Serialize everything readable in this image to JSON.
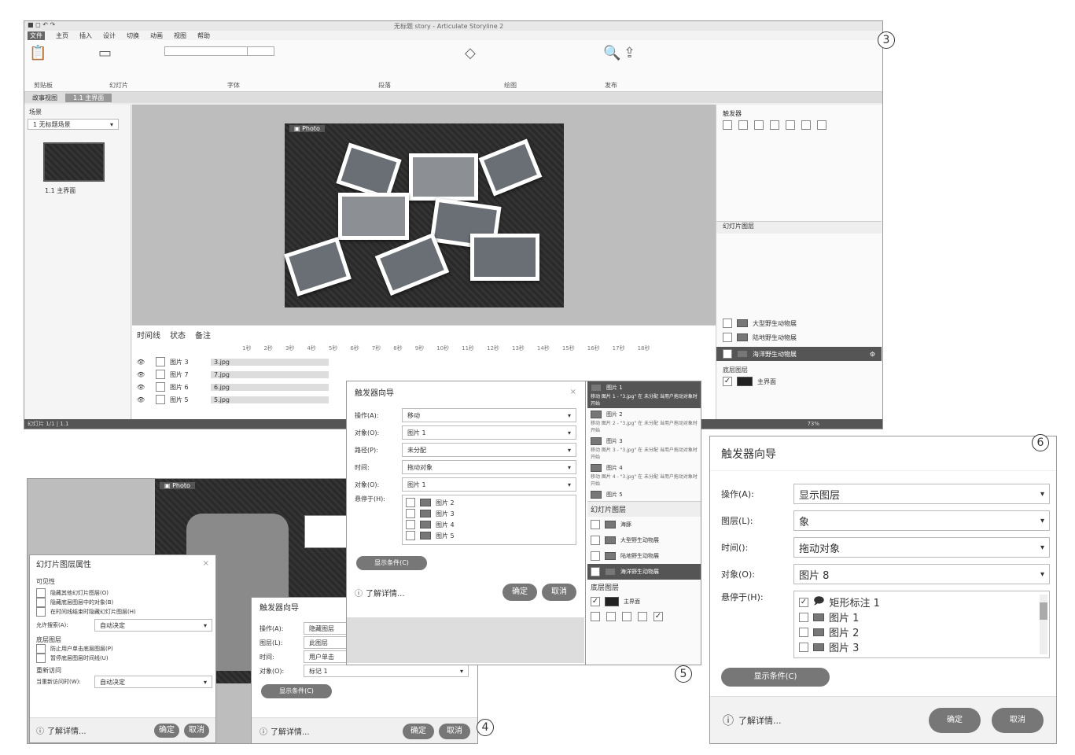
{
  "app": {
    "title": "无标题 story - Articulate Storyline 2",
    "ribbon_tabs": [
      "文件",
      "主页",
      "插入",
      "设计",
      "切换",
      "动画",
      "视图",
      "帮助"
    ],
    "ribbon_groups": [
      "剪贴板",
      "幻灯片",
      "字体",
      "段落",
      "绘图",
      "发布"
    ],
    "doc_tabs": [
      "故事视图",
      "1.1 主界面"
    ],
    "scene_panel": {
      "title": "场景",
      "dropdown": "1 无标题场景",
      "slide_label": "1.1 主界面"
    },
    "stage_tag": "Photo",
    "timeline_tabs": [
      "时间线",
      "状态",
      "备注"
    ],
    "timeline_rows": [
      {
        "name": "图片 3",
        "file": "3.jpg"
      },
      {
        "name": "图片 7",
        "file": "7.jpg"
      },
      {
        "name": "图片 6",
        "file": "6.jpg"
      },
      {
        "name": "图片 5",
        "file": "5.jpg"
      }
    ],
    "ruler": [
      "1秒",
      "2秒",
      "3秒",
      "4秒",
      "5秒",
      "6秒",
      "7秒",
      "8秒",
      "9秒",
      "10秒",
      "11秒",
      "12秒",
      "13秒",
      "14秒",
      "15秒",
      "16秒",
      "17秒",
      "18秒"
    ],
    "triggers_title": "触发器",
    "slide_layers_title": "幻灯片图层",
    "layers": [
      {
        "name": "大型野生动物展",
        "selected": false
      },
      {
        "name": "陆地野生动物展",
        "selected": false
      },
      {
        "name": "海洋野生动物展",
        "selected": true
      }
    ],
    "base_layer_title": "底层图层",
    "base_layer_name": "主界面",
    "status_left": "幻灯片 1/1 | 1.1",
    "zoom": "73%"
  },
  "labels": {
    "c3": "3",
    "c4": "4",
    "c5": "5",
    "c6": "6"
  },
  "dlg4a": {
    "title": "幻灯片图层属性",
    "visibility": "可见性",
    "v_opts": [
      "隐藏其他幻灯片图层(O)",
      "隐藏底层图层中的对象(B)",
      "在时间线结束时隐藏幻灯片图层(H)"
    ],
    "player_label": "允许搜索(A):",
    "player_value": "自动决定",
    "base_title": "底层图层",
    "base_opts": [
      "防止用户单击底层图层(P)",
      "暂停底层图层时间线(U)"
    ],
    "revisit": "重新访问",
    "revisit_label": "当重新访问时(W):",
    "revisit_value": "自动决定",
    "learn": "了解详情...",
    "ok": "确定",
    "cancel": "取消"
  },
  "dlg4b": {
    "title": "触发器向导",
    "rows": [
      {
        "label": "操作(A):",
        "value": "隐藏图层"
      },
      {
        "label": "图层(L):",
        "value": "此图层"
      },
      {
        "label": "时间:",
        "value": "用户单击"
      },
      {
        "label": "对象(O):",
        "value": "标记 1"
      }
    ],
    "cond_btn": "显示条件(C)",
    "learn": "了解详情...",
    "ok": "确定",
    "cancel": "取消"
  },
  "dlg5": {
    "title": "触发器向导",
    "rows": [
      {
        "label": "操作(A):",
        "value": "移动"
      },
      {
        "label": "对象(O):",
        "value": "图片 1"
      },
      {
        "label": "路径(P):",
        "value": "未分配"
      },
      {
        "label": "时间:",
        "value": "拖动对象"
      },
      {
        "label": "对象(O):",
        "value": "图片 1"
      }
    ],
    "hover_label": "悬停于(H):",
    "hover_items": [
      "图片 2",
      "图片 3",
      "图片 4",
      "图片 5"
    ],
    "cond_btn": "显示条件(C)",
    "learn": "了解详情...",
    "ok": "确定",
    "cancel": "取消"
  },
  "panel5": {
    "items": [
      {
        "name": "图片 1",
        "desc": "移动 图片 1 - \"3.jpg\" 在 未分配 当用户拖动对象时 开始"
      },
      {
        "name": "图片 2",
        "desc": "移动 图片 2 - \"3.jpg\" 在 未分配 当用户拖动对象时 开始"
      },
      {
        "name": "图片 3",
        "desc": "移动 图片 3 - \"3.jpg\" 在 未分配 当用户拖动对象时 开始"
      },
      {
        "name": "图片 4",
        "desc": "移动 图片 4 - \"3.jpg\" 在 未分配 当用户拖动对象时 开始"
      },
      {
        "name": "图片 5",
        "desc": ""
      }
    ],
    "slide_layers": "幻灯片图层",
    "layers": [
      "海豚",
      "大型野生动物展",
      "陆地野生动物展",
      "海洋野生动物展"
    ],
    "base_layer": "底层图层",
    "base_name": "主界面"
  },
  "dlg6": {
    "title": "触发器向导",
    "rows": [
      {
        "label": "操作(A):",
        "value": "显示图层"
      },
      {
        "label": "图层(L):",
        "value": "象"
      },
      {
        "label": "时间():",
        "value": "拖动对象"
      },
      {
        "label": "对象(O):",
        "value": "图片 8"
      }
    ],
    "hover_label": "悬停于(H):",
    "hover_items": [
      {
        "name": "矩形标注 1",
        "checked": true
      },
      {
        "name": "图片 1",
        "checked": false
      },
      {
        "name": "图片 2",
        "checked": false
      },
      {
        "name": "图片 3",
        "checked": false
      }
    ],
    "cond_btn": "显示条件(C)",
    "learn": "了解详情...",
    "ok": "确定",
    "cancel": "取消"
  }
}
